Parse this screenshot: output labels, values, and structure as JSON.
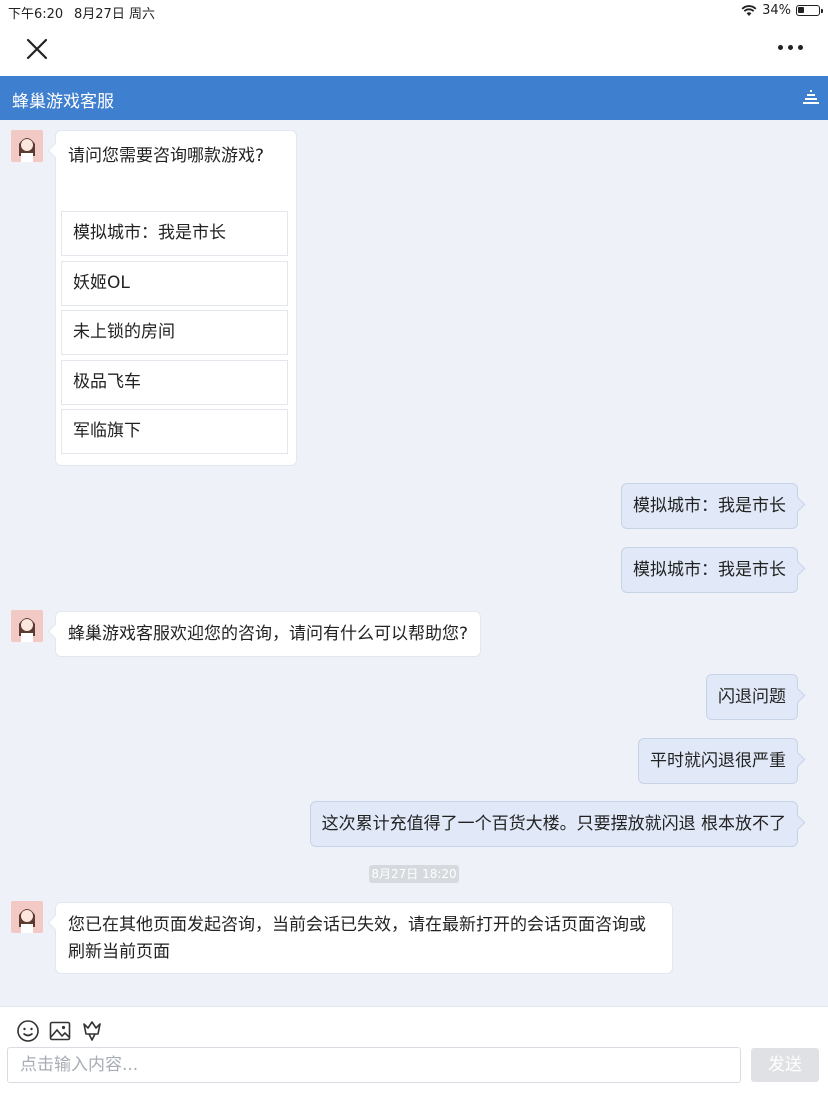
{
  "status_bar": {
    "time": "下午6:20",
    "date": "8月27日 周六",
    "battery": "34%",
    "battery_level": 0.34
  },
  "nav": {
    "close_icon": "close-icon",
    "more_icon": "more-icon"
  },
  "header": {
    "title": "蜂巢游戏客服",
    "accent_color": "#3f7fcf"
  },
  "messages": {
    "options_question": "请问您需要咨询哪款游戏?",
    "options": [
      "模拟城市：我是市长",
      "妖姬OL",
      "未上锁的房间",
      "极品飞车",
      "军临旗下"
    ],
    "user_1": "模拟城市：我是市长",
    "user_2": "模拟城市：我是市长",
    "agent_welcome": "蜂巢游戏客服欢迎您的咨询，请问有什么可以帮助您?",
    "user_3": "闪退问题",
    "user_4": "平时就闪退很严重",
    "user_5": "这次累计充值得了一个百货大楼。只要摆放就闪退 根本放不了",
    "timestamp": "8月27日 18:20",
    "agent_expired": "您已在其他页面发起咨询，当前会话已失效，请在最新打开的会话页面咨询或刷新当前页面"
  },
  "input": {
    "placeholder": "点击输入内容...",
    "send_label": "发送",
    "tools": [
      "emoji-icon",
      "image-icon",
      "rating-icon"
    ]
  }
}
